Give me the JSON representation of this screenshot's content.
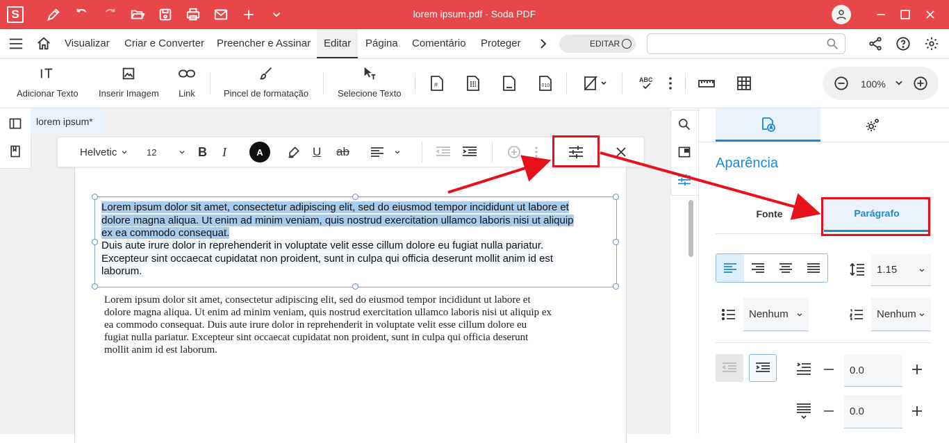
{
  "window": {
    "app_logo": "S",
    "title": "lorem ipsum.pdf   -   Soda PDF",
    "quick_icons": [
      "pen-icon",
      "undo-icon",
      "redo-icon",
      "open-folder-icon",
      "save-icon",
      "print-icon",
      "mail-icon",
      "plus-icon",
      "chevron-down-icon"
    ],
    "controls": [
      "user-icon",
      "minimize-icon",
      "maximize-icon",
      "close-icon"
    ]
  },
  "menu": {
    "items": [
      "Visualizar",
      "Criar e Converter",
      "Preencher e Assinar",
      "Editar",
      "Página",
      "Comentário",
      "Proteger"
    ],
    "active": "Editar",
    "edit_toggle_label": "EDITAR",
    "search_placeholder": ""
  },
  "ribbon": {
    "add_text": "Adicionar Texto",
    "insert_image": "Inserir Imagem",
    "link": "Link",
    "format_brush": "Pincel de formatação",
    "select_text": "Selecione Texto",
    "spell_label": "ABC",
    "zoom": "100%"
  },
  "document": {
    "tab_title": "lorem ipsum",
    "tab_modified_marker": "*",
    "font_name": "Helvetic",
    "font_size": "12",
    "color_letter": "A",
    "textbox_lines": [
      {
        "text": "Lorem ipsum dolor sit amet, consectetur adipiscing elit, sed do eiusmod tempor incididunt ut labore et",
        "selected": true
      },
      {
        "text": "dolore magna aliqua. Ut enim ad minim veniam, quis nostrud exercitation ullamco laboris nisi ut aliquip",
        "selected": true
      },
      {
        "text": "ex ea commodo consequat.",
        "selected": true
      },
      {
        "text": "Duis aute irure dolor in reprehenderit in voluptate velit esse cillum dolore eu fugiat nulla pariatur.",
        "selected": false
      },
      {
        "text": "Excepteur sint occaecat cupidatat non proident, sunt in culpa qui officia deserunt mollit anim id est",
        "selected": false
      },
      {
        "text": "laborum.",
        "selected": false
      }
    ],
    "body_lines": [
      "Lorem ipsum dolor sit amet, consectetur adipiscing elit, sed do eiusmod tempor incididunt ut labore et",
      "dolore magna aliqua. Ut enim ad minim veniam, quis nostrud exercitation ullamco laboris nisi ut aliquip ex",
      "ea commodo consequat. Duis aute irure dolor in reprehenderit in voluptate velit esse cillum dolore eu",
      "fugiat nulla pariatur. Excepteur sint occaecat cupidatat non proident, sunt in culpa qui officia deserunt",
      "mollit anim id est laborum."
    ]
  },
  "panel": {
    "heading": "Aparência",
    "tab_font": "Fonte",
    "tab_paragraph": "Parágrafo",
    "line_spacing": "1.15",
    "bullet_list": "Nenhum",
    "numbered_list": "Nenhum",
    "indent_value": "0.0",
    "spacing_value": "0.0"
  },
  "colors": {
    "brand_red": "#e8474a",
    "accent_blue": "#1a8ad4",
    "annotation_red": "#e8101a",
    "selection_blue": "#a9cbec"
  }
}
